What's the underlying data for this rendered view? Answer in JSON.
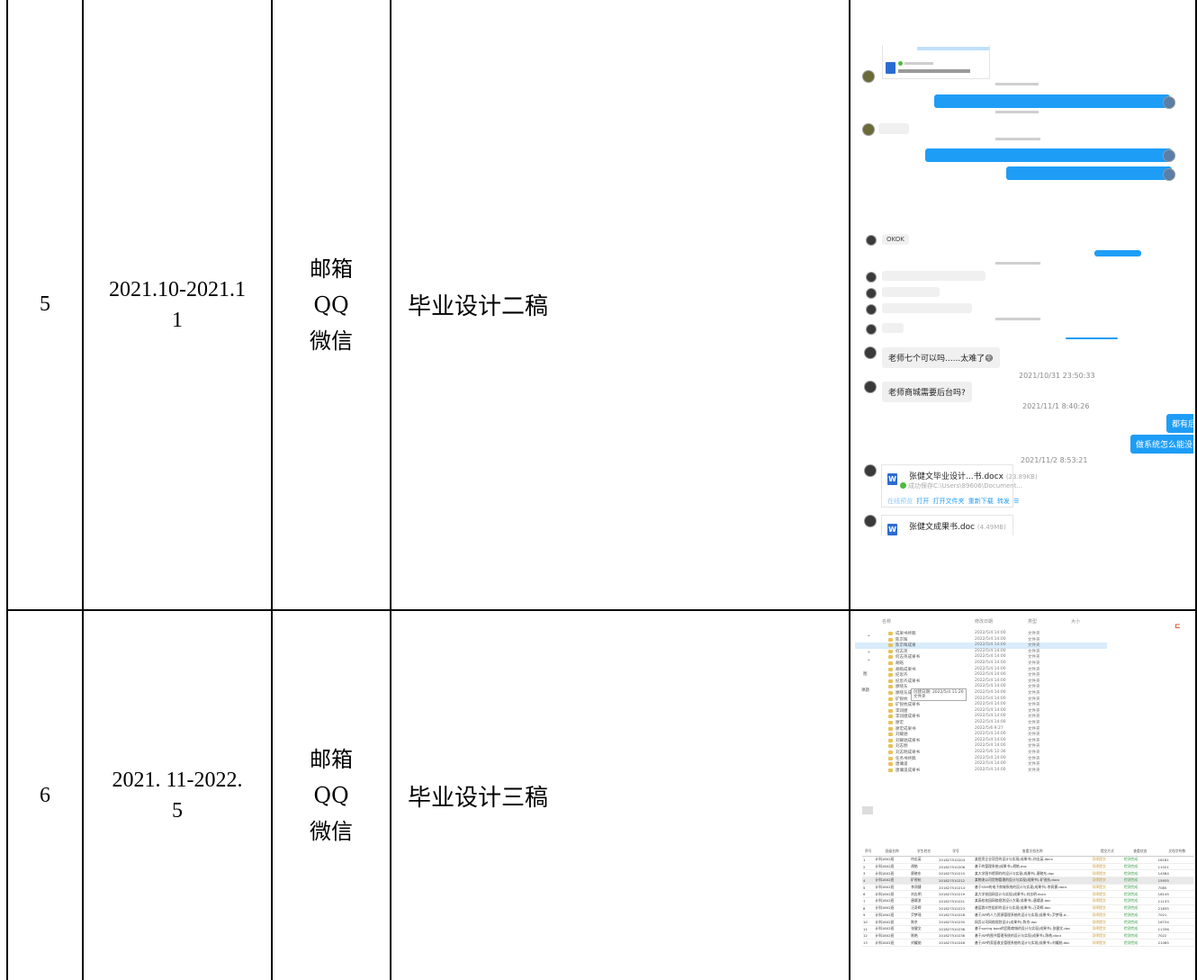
{
  "rows": [
    {
      "index": "5",
      "date_line1": "2021.10-2021.1",
      "date_line2": "1",
      "contacts": [
        "邮箱",
        "QQ",
        "微信"
      ],
      "task": "毕业设计二稿"
    },
    {
      "index": "6",
      "date_line1": "2021. 11-2022.",
      "date_line2": "5",
      "contacts": [
        "邮箱",
        "QQ",
        "微信"
      ],
      "task": "毕业设计三稿"
    }
  ],
  "chat": {
    "ts1": "2021/10/31 23:50:33",
    "msg_q1": "老师七个可以吗......太难了😅",
    "msg_q2": "老师商城需要后台吗?",
    "ts2": "2021/11/1 8:40:26",
    "reply1": "都有后台",
    "reply2": "做系统怎么能没有后台",
    "ts3": "2021/11/2 8:53:21",
    "file1_name": "张健文毕业设计...书.docx",
    "file1_size": "(23.89KB)",
    "file1_status": "成功保存C:\\Users\\89606\\Document...",
    "file1_actions": [
      "在线预览",
      "打开",
      "打开文件夹",
      "重新下载",
      "转发",
      "☰"
    ],
    "file2_name": "张健文成果书.doc",
    "file2_size": "(4.49MB)",
    "small_bubble": "OKOK",
    "word_icon": "W"
  },
  "filemgr": {
    "headers": [
      "名称",
      "修改日期",
      "类型",
      "大小"
    ],
    "tooltip_line1": "创建日期: 2022/5/4 11:26",
    "tooltip_line2": "文件夹",
    "rows": [
      {
        "name": "成果书终稿",
        "date": "2022/5/4 14:00",
        "type": "文件夹"
      },
      {
        "name": "陈京晖",
        "date": "2022/5/4 14:00",
        "type": "文件夹"
      },
      {
        "name": "陈京晖成果",
        "date": "2022/5/4 14:00",
        "type": "文件夹"
      },
      {
        "name": "何志英",
        "date": "2022/5/4 14:00",
        "type": "文件夹"
      },
      {
        "name": "何志英成果书",
        "date": "2022/5/4 14:00",
        "type": "文件夹"
      },
      {
        "name": "胡皓",
        "date": "2022/5/4 14:00",
        "type": "文件夹"
      },
      {
        "name": "胡皓成果书",
        "date": "2022/5/4 14:00",
        "type": "文件夹"
      },
      {
        "name": "纪思齐",
        "date": "2022/5/4 14:00",
        "type": "文件夹"
      },
      {
        "name": "纪思齐成果书",
        "date": "2022/5/4 14:00",
        "type": "文件夹"
      },
      {
        "name": "廖晓东",
        "date": "2022/5/4 14:00",
        "type": "文件夹"
      },
      {
        "name": "廖晓东成果书",
        "date": "2022/5/4 14:00",
        "type": "文件夹"
      },
      {
        "name": "矿锐杭",
        "date": "2022/5/4 14:00",
        "type": "文件夹"
      },
      {
        "name": "矿锐杭成果书",
        "date": "2022/5/4 14:00",
        "type": "文件夹"
      },
      {
        "name": "李润捷",
        "date": "2022/5/4 14:00",
        "type": "文件夹"
      },
      {
        "name": "李润捷成果书",
        "date": "2022/5/4 14:00",
        "type": "文件夹"
      },
      {
        "name": "廖宏",
        "date": "2022/5/4 14:00",
        "type": "文件夹"
      },
      {
        "name": "廖宏成果书",
        "date": "2022/5/6 9:27",
        "type": "文件夹"
      },
      {
        "name": "刘耀驰",
        "date": "2022/5/4 14:00",
        "type": "文件夹"
      },
      {
        "name": "刘耀驰成果书",
        "date": "2022/5/4 14:00",
        "type": "文件夹"
      },
      {
        "name": "刘志明",
        "date": "2022/5/4 14:00",
        "type": "文件夹"
      },
      {
        "name": "刘志明成果书",
        "date": "2022/5/6 12:36",
        "type": "文件夹"
      },
      {
        "name": "任务书终稿",
        "date": "2022/5/4 14:00",
        "type": "文件夹"
      },
      {
        "name": "唐墉浚",
        "date": "2022/5/4 14:00",
        "type": "文件夹"
      },
      {
        "name": "唐墉浚成果书",
        "date": "2022/5/4 14:00",
        "type": "文件夹"
      }
    ],
    "side_labels": [
      "图",
      "课题"
    ],
    "table_headers": [
      "序号",
      "班级名称",
      "学生姓名",
      "学号",
      "查重文档名称",
      "提交方式",
      "查重状态",
      "文档字符数"
    ],
    "table_rows": [
      [
        "1",
        "计科1802班",
        "何志英",
        "201827510204",
        "某投资企业项目的设计与实现(成果书)-何志英.docx",
        "导师提交",
        "检测完成",
        "16181"
      ],
      [
        "2",
        "计科1802班",
        "胡皓",
        "201827510206",
        "基于的管理系统(成果书)-胡皓.doc",
        "导师提交",
        "检测完成",
        "11021"
      ],
      [
        "3",
        "计科1802班",
        "廖晓东",
        "201827510210",
        "某大学图书馆预约的设计与实现(成果书)-廖晓东.doc",
        "导师提交",
        "检测完成",
        "14584"
      ],
      [
        "4",
        "计科1802班",
        "矿锐杭",
        "201827510212",
        "某物流公司货物管理的设计与实现(成果书)-矿锐杭.docx",
        "导师提交",
        "检测完成",
        "15935"
      ],
      [
        "5",
        "计科1802班",
        "李润捷",
        "201827510214",
        "基于SSM的电子商城系统的设计与实现(成果书)-李润捷.docx",
        "导师提交",
        "检测完成",
        "7085"
      ],
      [
        "6",
        "计科1802班",
        "刘志明",
        "201827510219",
        "某大学校园网设计与实现(成果书)-刘志明.docx",
        "导师提交",
        "检测完成",
        "16145"
      ],
      [
        "7",
        "计科1802班",
        "唐墉浚",
        "201827510221",
        "某高校校园网络规划设计方案(成果书)-唐墉浚.doc",
        "导师提交",
        "检测完成",
        "11133"
      ],
      [
        "8",
        "计科1802班",
        "汪奇辉",
        "201827510223",
        "基层群众性组织的设计与实现(成果书)-汪奇辉.doc",
        "导师提交",
        "检测完成",
        "21835"
      ],
      [
        "9",
        "计科1802班",
        "尹梦瑶",
        "201827510228",
        "基于JSP的人力资源管理系统的设计与实现(成果书)-尹梦瑶.d...",
        "导师提交",
        "检测完成",
        "7021"
      ],
      [
        "10",
        "计科1802班",
        "陈京",
        "201827510230",
        "网页公司网络规划设计(成果书)-陈京.doc",
        "导师提交",
        "检测完成",
        "16734"
      ],
      [
        "11",
        "计科1802班",
        "张健文",
        "201827510236",
        "基于spring boot的团购商城的设计与实现(成果书)-张健文.doc",
        "导师提交",
        "检测完成",
        "11336"
      ],
      [
        "12",
        "计科1802班",
        "陈皓",
        "201827510238",
        "基于JSP的图书管理系统的设计与实现(成果书)-陈皓.docx",
        "导师提交",
        "检测完成",
        "7022"
      ],
      [
        "13",
        "计科1802班",
        "刘耀驰",
        "201827510246",
        "基于JSP的家庭收支管理系统的设计与实现(成果书)-刘耀驰.doc",
        "导师提交",
        "检测完成",
        "21065"
      ]
    ]
  }
}
